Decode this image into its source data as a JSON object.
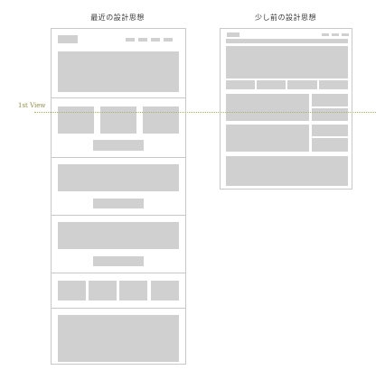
{
  "left_mockup": {
    "title": "最近の設計思想"
  },
  "right_mockup": {
    "title": "少し前の設計思想"
  },
  "first_view": {
    "label": "1st View"
  }
}
